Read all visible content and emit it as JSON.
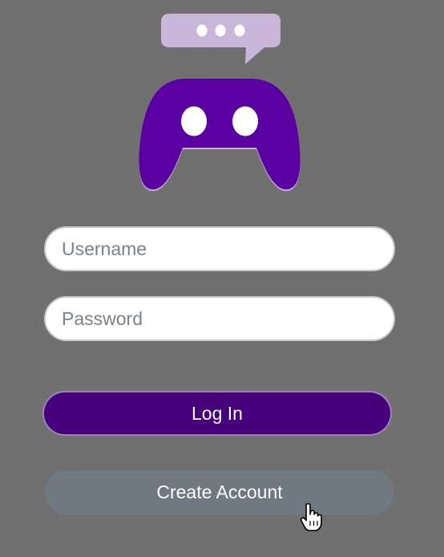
{
  "colors": {
    "background": "#707070",
    "brand_purple": "#5b00a0",
    "bubble_lilac": "#c9b6d9",
    "login_button": "#45007a",
    "create_button": "#707982",
    "placeholder": "#7a8289"
  },
  "logo": {
    "icons": [
      "chat-bubble-icon",
      "gamepad-icon"
    ]
  },
  "form": {
    "username": {
      "placeholder": "Username",
      "value": ""
    },
    "password": {
      "placeholder": "Password",
      "value": ""
    },
    "login_label": "Log In",
    "create_label": "Create Account"
  },
  "cursor": {
    "icon": "hand-pointer-icon"
  }
}
